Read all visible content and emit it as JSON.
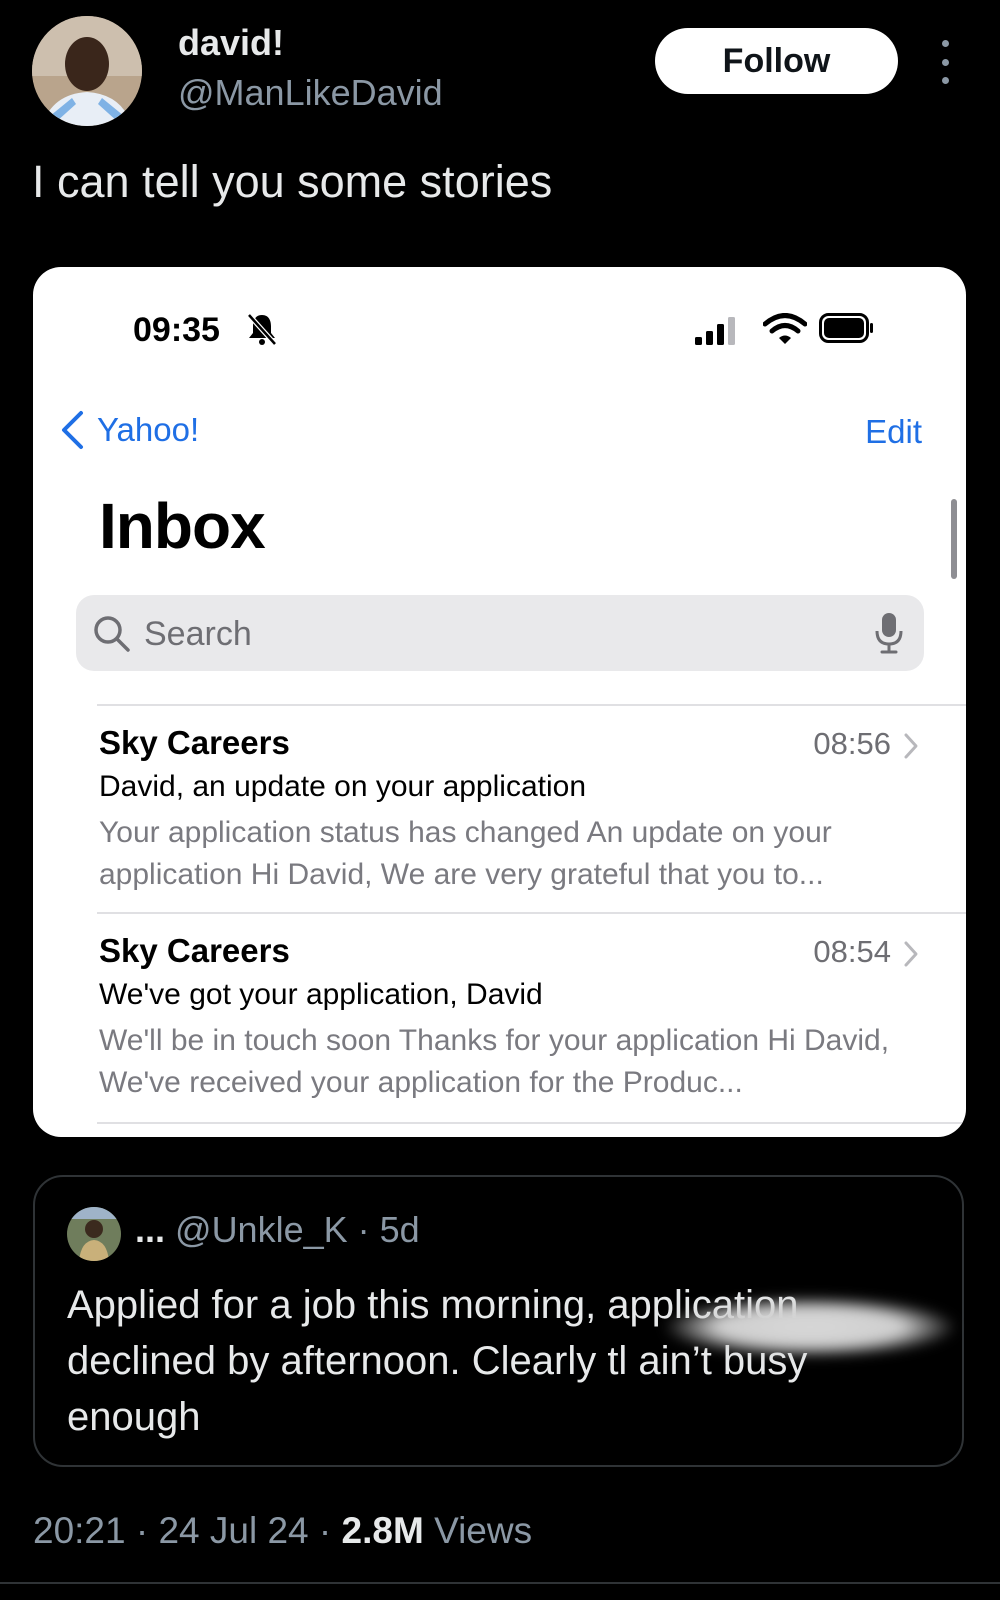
{
  "tweet": {
    "author_name": "david!",
    "author_handle": "@ManLikeDavid",
    "follow_label": "Follow",
    "text": "I can tell you some stories",
    "timestamp": "20:21 · 24 Jul 24 · ",
    "views_count": "2.8M",
    "views_label": " Views"
  },
  "phone": {
    "status_time": "09:35",
    "back_label": "Yahoo!",
    "edit_label": "Edit",
    "title": "Inbox",
    "search_placeholder": "Search",
    "mails": [
      {
        "sender": "Sky Careers",
        "time": "08:56",
        "subject": "David, an update on your application",
        "preview": "Your application status has changed An update on your application Hi David, We are very grateful that you to..."
      },
      {
        "sender": "Sky Careers",
        "time": "08:54",
        "subject": "We've got your application, David",
        "preview": "We'll be in touch soon Thanks for your application Hi David, We've received your application for the Produc..."
      }
    ]
  },
  "quote": {
    "name_dots": "...",
    "handle_time": " @Unkle_K · 5d",
    "text": "Applied for a job this morning, application declined by afternoon. Clearly tl ain’t busy enough"
  },
  "colors": {
    "background": "#000000",
    "link_blue": "#1f6fe5",
    "muted": "#8b98a5"
  }
}
